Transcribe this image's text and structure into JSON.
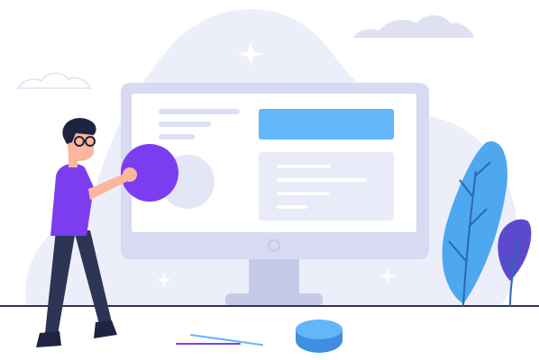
{
  "illustration": {
    "subject": "person-interacting-with-monitor",
    "colors": {
      "background": "#ffffff",
      "backdrop_blob": "#eceef9",
      "cloud_outline": "#dfe1f3",
      "monitor_frame": "#d7daf2",
      "monitor_screen": "#ffffff",
      "monitor_stand": "#c6cae9",
      "screen_lines": "#dde0f4",
      "screen_banner": "#63b6fa",
      "screen_card": "#e9ebf9",
      "card_lines": "#ffffff",
      "ghost_circle": "#e3e6f6",
      "purple_ball": "#7c3df0",
      "shirt": "#7c3df0",
      "pants": "#2e3454",
      "skin": "#fbb69c",
      "hair": "#1f2340",
      "shoes": "#1f2340",
      "plant_blue": "#4ea8f0",
      "plant_violet": "#5d49ce",
      "plant_stem": "#2a68b4",
      "disc_top": "#63b6fa",
      "disc_side": "#3e8fe0",
      "ground_line": "#2e3454",
      "floor_line_blue": "#63b6fa",
      "floor_line_purple": "#7c3df0",
      "sparkle": "#ffffff"
    },
    "icons": [
      "cloud-icon",
      "sparkle-icon",
      "monitor-icon",
      "power-button-icon",
      "plant-icon",
      "disc-icon"
    ]
  }
}
